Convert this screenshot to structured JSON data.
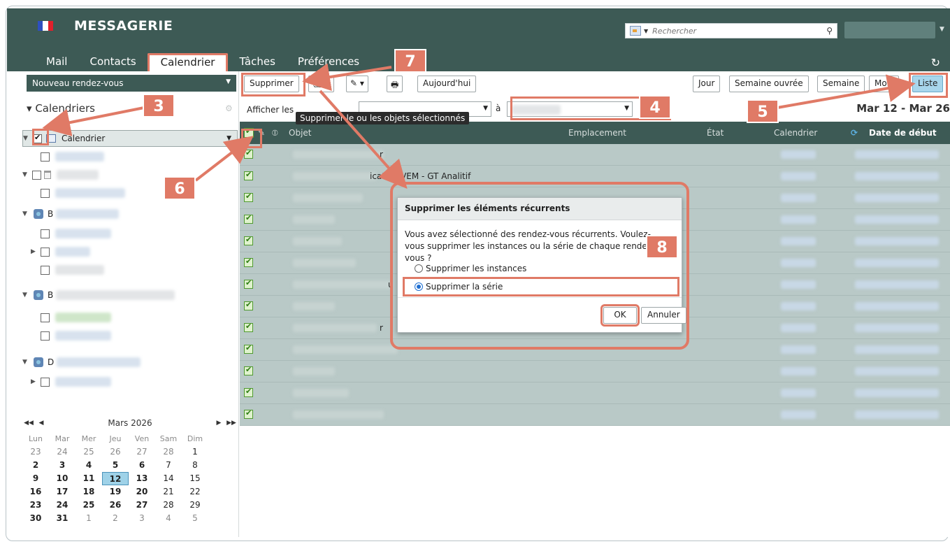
{
  "header": {
    "brand": "MESSAGERIE",
    "search_placeholder": "Rechercher",
    "tabs": [
      {
        "label": "Mail"
      },
      {
        "label": "Contacts"
      },
      {
        "label": "Calendrier",
        "active": true
      },
      {
        "label": "Tâches"
      },
      {
        "label": "Préférences"
      }
    ]
  },
  "sidebar": {
    "new_button": "Nouveau rendez-vous",
    "section_title": "Calendriers",
    "calendar_label": "Calendrier",
    "group_initials": [
      "B",
      "B",
      "D"
    ]
  },
  "mini_calendar": {
    "title": "Mars 2026",
    "weekdays": [
      "Lun",
      "Mar",
      "Mer",
      "Jeu",
      "Ven",
      "Sam",
      "Dim"
    ],
    "weeks": [
      [
        "23",
        "24",
        "25",
        "26",
        "27",
        "28",
        "1"
      ],
      [
        "2",
        "3",
        "4",
        "5",
        "6",
        "7",
        "8"
      ],
      [
        "9",
        "10",
        "11",
        "12",
        "13",
        "14",
        "15"
      ],
      [
        "16",
        "17",
        "18",
        "19",
        "20",
        "21",
        "22"
      ],
      [
        "23",
        "24",
        "25",
        "26",
        "27",
        "28",
        "29"
      ],
      [
        "30",
        "31",
        "1",
        "2",
        "3",
        "4",
        "5"
      ]
    ],
    "today": "12"
  },
  "toolbar": {
    "delete": "Supprimer",
    "today": "Aujourd'hui",
    "views": [
      "Jour",
      "Semaine ouvrée",
      "Semaine",
      "Mois",
      "Liste"
    ],
    "active_view": "Liste"
  },
  "filter": {
    "label": "Afficher les",
    "to": "à",
    "range": "Mar 12 - Mar 26"
  },
  "tooltip": "Supprimer le ou les objets sélectionnés",
  "grid": {
    "columns": [
      "Objet",
      "Emplacement",
      "État",
      "Calendrier",
      "Date de début"
    ],
    "visible_fragments": [
      "r",
      "ication VEM - GT Analitif",
      "u",
      "r"
    ]
  },
  "dialog": {
    "title": "Supprimer les éléments récurrents",
    "message": "Vous avez sélectionné des rendez-vous récurrents. Voulez-vous supprimer les instances ou la série de chaque rendez-vous ?",
    "options": [
      "Supprimer les instances",
      "Supprimer la série"
    ],
    "selected_option": "Supprimer la série",
    "ok": "OK",
    "cancel": "Annuler"
  },
  "annotations": [
    "3",
    "4",
    "5",
    "6",
    "7",
    "8"
  ],
  "colors": {
    "brand": "#3d5a55",
    "annotation": "#e07a66",
    "active_view": "#a8d6ec"
  }
}
